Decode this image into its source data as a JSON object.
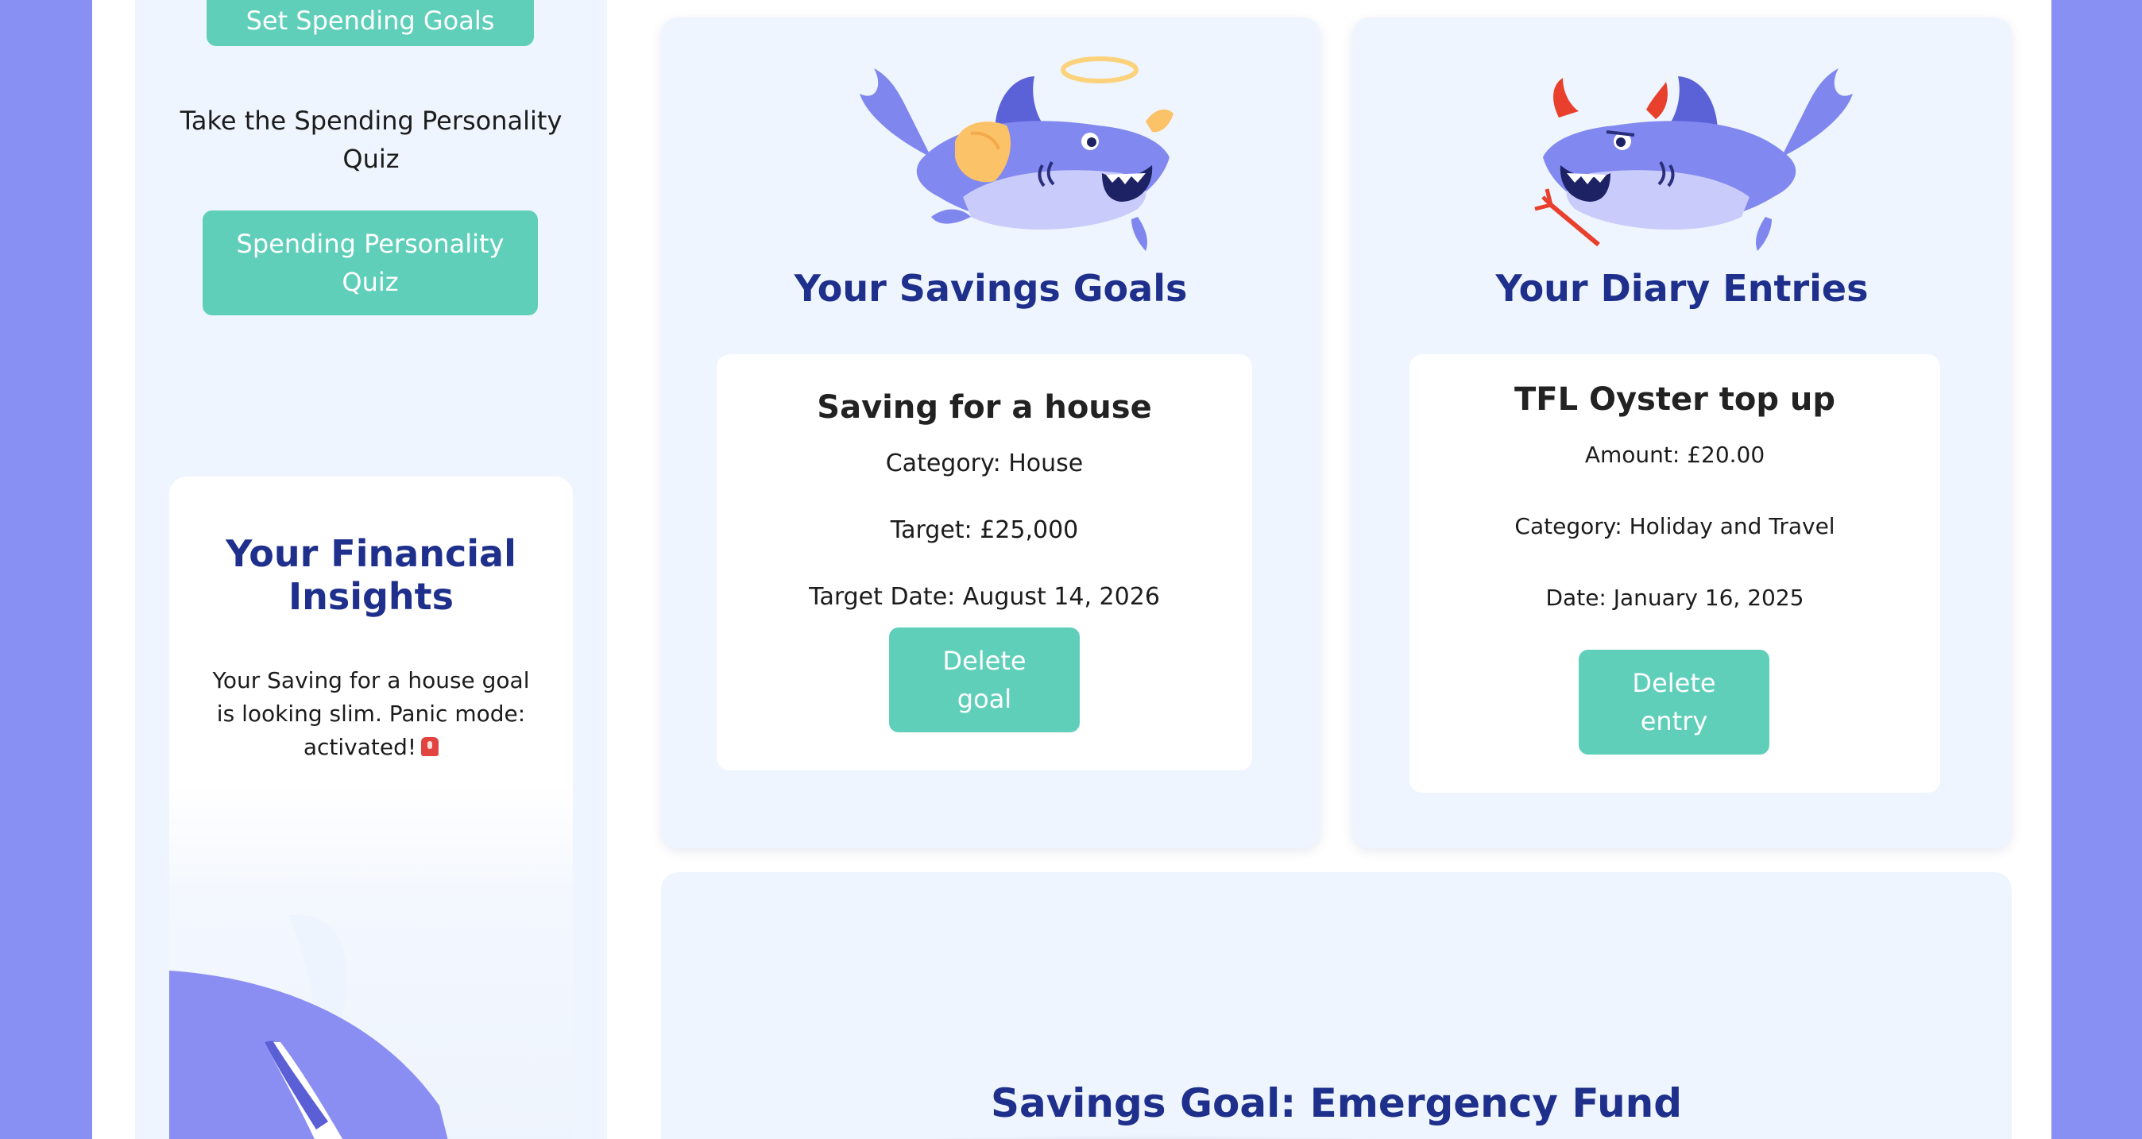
{
  "sidebar": {
    "set_goals_button": "Set Spending Goals",
    "quiz_prompt": "Take the Spending Personality Quiz",
    "quiz_button": "Spending Personality Quiz",
    "insights": {
      "title": "Your Financial Insights",
      "text": "Your Saving for a house goal is looking slim. Panic mode: activated!",
      "icon": "alarm-icon"
    }
  },
  "savings_goals": {
    "title": "Your Savings Goals",
    "illustration": "angel-shark-icon",
    "goal": {
      "name": "Saving for a house",
      "category": "Category:  House",
      "target": "Target:  £25,000",
      "target_date": "Target Date: August 14, 2026",
      "delete_button": "Delete goal"
    }
  },
  "diary_entries": {
    "title": "Your Diary Entries",
    "illustration": "devil-shark-icon",
    "entry": {
      "name": "TFL Oyster top up",
      "amount": "Amount: £20.00",
      "category": "Category: Holiday and Travel",
      "date": "Date: January 16, 2025",
      "delete_button": "Delete entry"
    }
  },
  "chart_section": {
    "title": "Savings Goal: Emergency Fund"
  },
  "colors": {
    "background": "#8890f4",
    "panel": "#eef5fe",
    "accent_button": "#5fcfba",
    "heading": "#1e2f8c"
  }
}
